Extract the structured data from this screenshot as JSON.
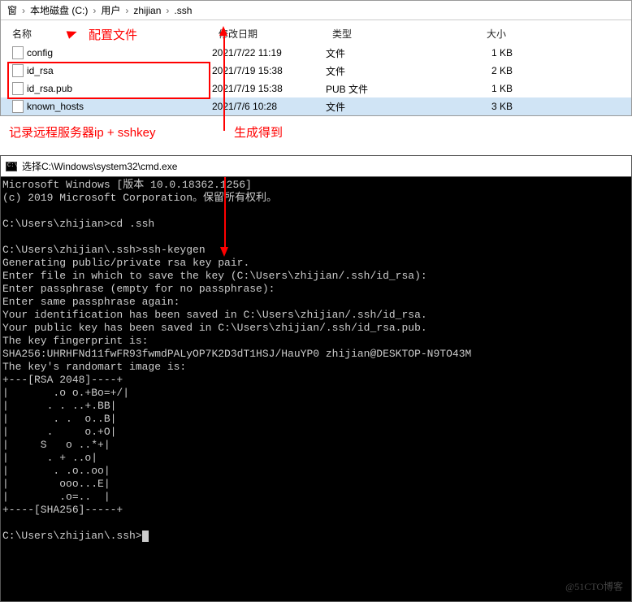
{
  "breadcrumb": {
    "items": [
      "窗",
      "本地磁盘 (C:)",
      "用户",
      "zhijian",
      ".ssh"
    ]
  },
  "columns": {
    "name": "名称",
    "date": "修改日期",
    "type": "类型",
    "size": "大小"
  },
  "files": [
    {
      "name": "config",
      "date": "2021/7/22 11:19",
      "type": "文件",
      "size": "1 KB",
      "sel": false
    },
    {
      "name": "id_rsa",
      "date": "2021/7/19 15:38",
      "type": "文件",
      "size": "2 KB",
      "sel": false
    },
    {
      "name": "id_rsa.pub",
      "date": "2021/7/19 15:38",
      "type": "PUB 文件",
      "size": "1 KB",
      "sel": false
    },
    {
      "name": "known_hosts",
      "date": "2021/7/6 10:28",
      "type": "文件",
      "size": "3 KB",
      "sel": true
    }
  ],
  "anno": {
    "config": "配置文件",
    "record": "记录远程服务器ip + sshkey",
    "gen": "生成得到"
  },
  "term_title": "选择C:\\Windows\\system32\\cmd.exe",
  "terminal_lines": [
    "Microsoft Windows [版本 10.0.18362.1256]",
    "(c) 2019 Microsoft Corporation。保留所有权利。",
    "",
    "C:\\Users\\zhijian>cd .ssh",
    "",
    "C:\\Users\\zhijian\\.ssh>ssh-keygen",
    "Generating public/private rsa key pair.",
    "Enter file in which to save the key (C:\\Users\\zhijian/.ssh/id_rsa):",
    "Enter passphrase (empty for no passphrase):",
    "Enter same passphrase again:",
    "Your identification has been saved in C:\\Users\\zhijian/.ssh/id_rsa.",
    "Your public key has been saved in C:\\Users\\zhijian/.ssh/id_rsa.pub.",
    "The key fingerprint is:",
    "SHA256:UHRHFNd11fwFR93fwmdPALyOP7K2D3dT1HSJ/HauYP0 zhijian@DESKTOP-N9TO43M",
    "The key's randomart image is:",
    "+---[RSA 2048]----+",
    "|       .o o.+Bo=+/|",
    "|      . . ..+.BB|",
    "|       . .  o..B|",
    "|      .     o.+O|",
    "|     S   o ..*+|",
    "|      . + ..o|",
    "|       . .o..oo|",
    "|        ooo...E|",
    "|        .o=..  |",
    "+----[SHA256]-----+",
    "",
    "C:\\Users\\zhijian\\.ssh>"
  ],
  "watermark": "@51CTO博客"
}
